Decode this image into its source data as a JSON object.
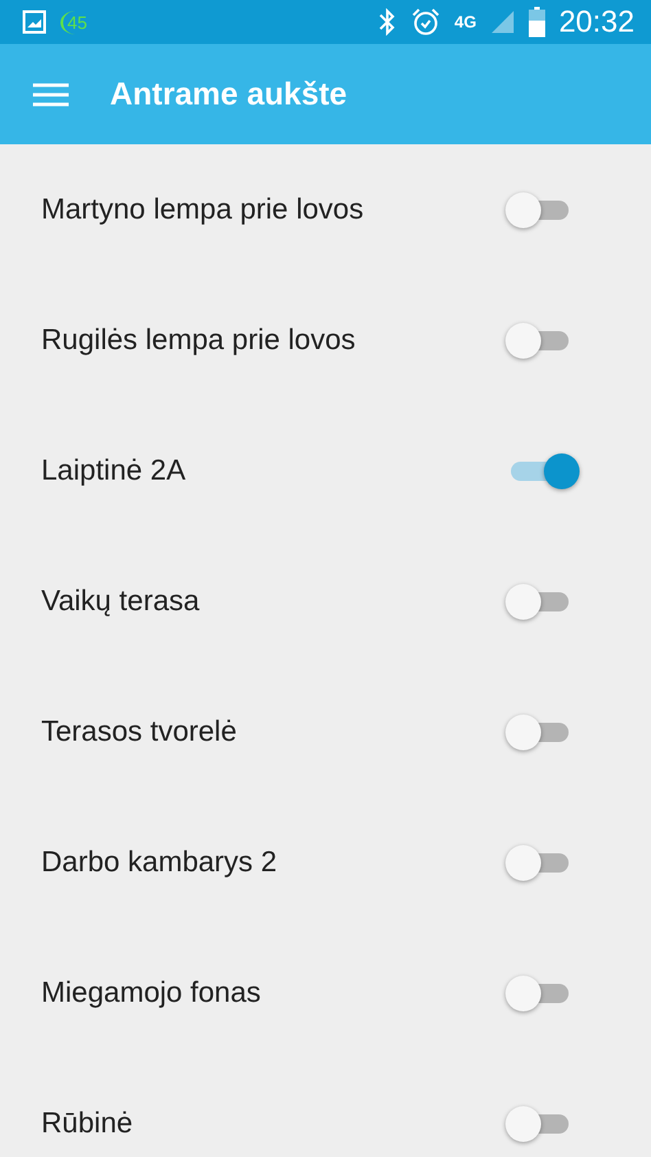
{
  "status_bar": {
    "badge": "45",
    "network": "4G",
    "time": "20:32"
  },
  "app_bar": {
    "title": "Antrame aukšte"
  },
  "switches": [
    {
      "label": "Martyno lempa prie lovos",
      "on": false
    },
    {
      "label": "Rugilės lempa prie lovos",
      "on": false
    },
    {
      "label": "Laiptinė 2A",
      "on": true
    },
    {
      "label": "Vaikų terasa",
      "on": false
    },
    {
      "label": "Terasos tvorelė",
      "on": false
    },
    {
      "label": "Darbo kambarys 2",
      "on": false
    },
    {
      "label": "Miegamojo fonas",
      "on": false
    },
    {
      "label": "Rūbinė",
      "on": false
    }
  ]
}
